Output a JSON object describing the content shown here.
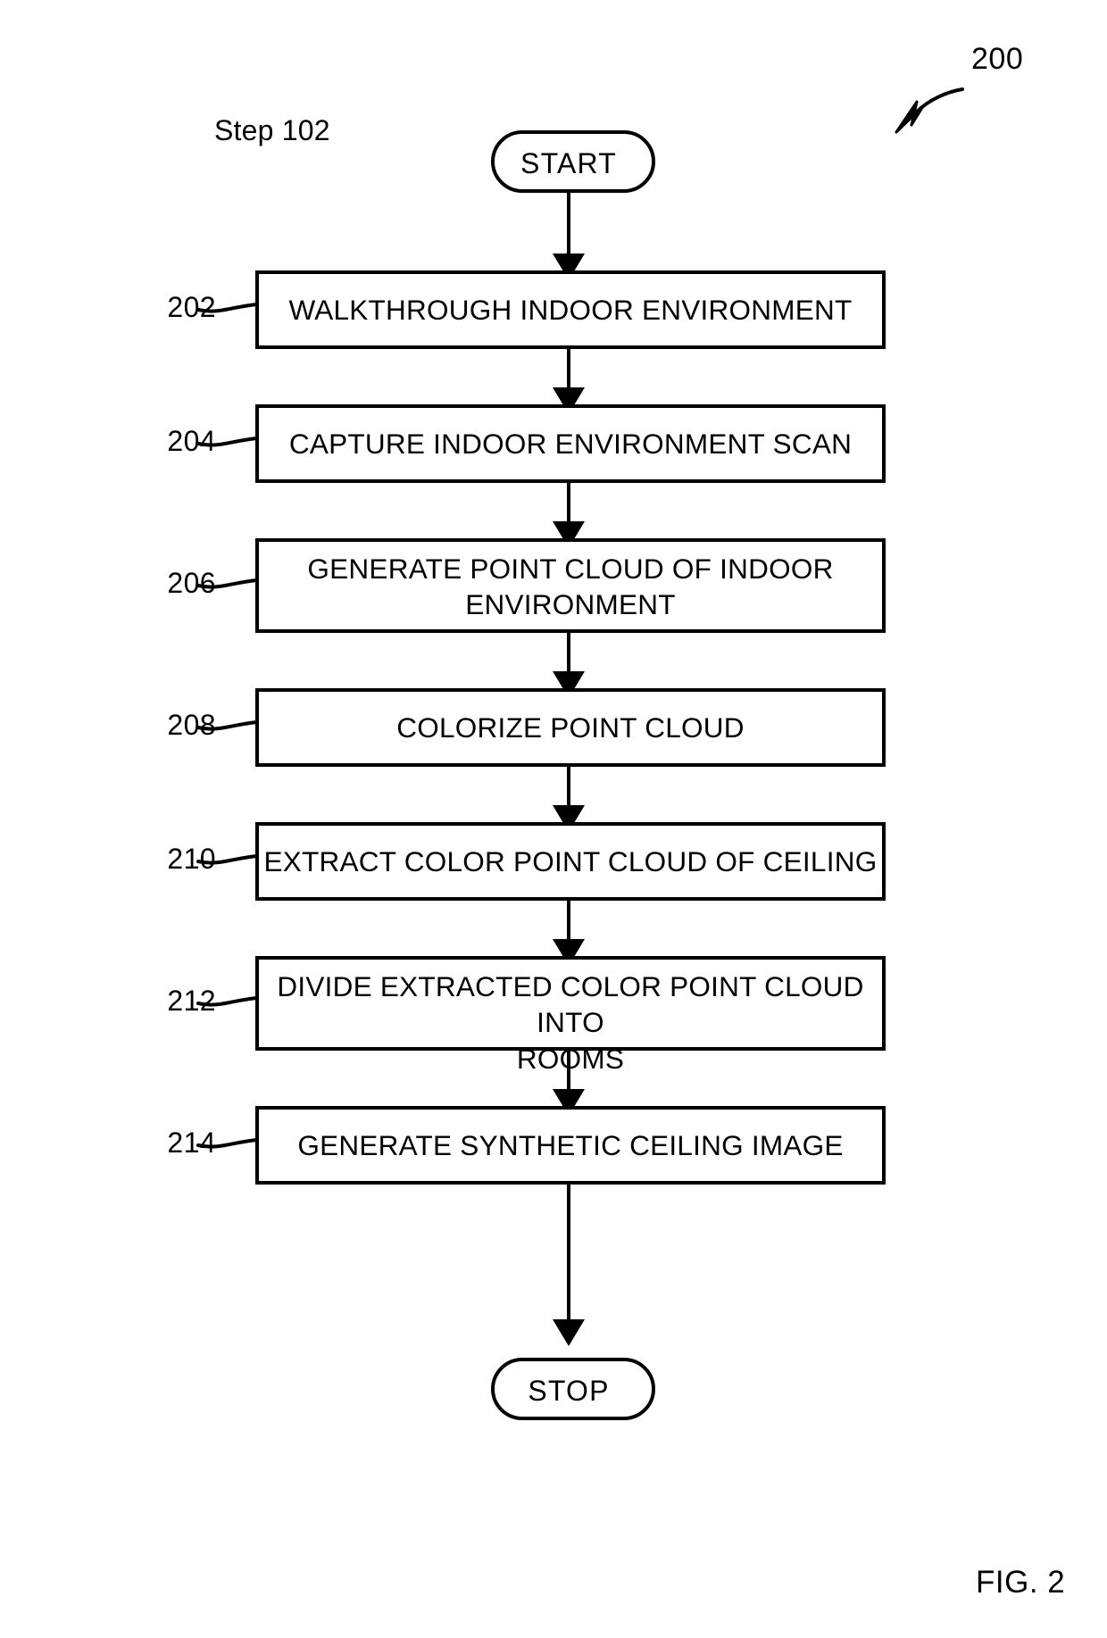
{
  "figure": {
    "reference_number": "200",
    "caption": "FIG. 2",
    "step_label": "Step 102"
  },
  "flowchart": {
    "type": "flowchart",
    "orientation": "top-to-bottom",
    "start_terminator": {
      "label": "START",
      "shape": "stadium"
    },
    "stop_terminator": {
      "label": "STOP",
      "shape": "stadium"
    },
    "steps": [
      {
        "ref": "202",
        "lines": [
          "WALKTHROUGH INDOOR ENVIRONMENT"
        ]
      },
      {
        "ref": "204",
        "lines": [
          "CAPTURE INDOOR ENVIRONMENT SCAN"
        ]
      },
      {
        "ref": "206",
        "lines": [
          "GENERATE POINT CLOUD OF INDOOR",
          "ENVIRONMENT"
        ]
      },
      {
        "ref": "208",
        "lines": [
          "COLORIZE POINT CLOUD"
        ]
      },
      {
        "ref": "210",
        "lines": [
          "EXTRACT COLOR POINT CLOUD OF CEILING"
        ]
      },
      {
        "ref": "212",
        "lines": [
          "DIVIDE EXTRACTED COLOR POINT CLOUD INTO",
          "ROOMS"
        ]
      },
      {
        "ref": "214",
        "lines": [
          "GENERATE SYNTHETIC CEILING IMAGE"
        ]
      }
    ]
  },
  "colors": {
    "ink": "#000000",
    "paper": "#ffffff"
  }
}
